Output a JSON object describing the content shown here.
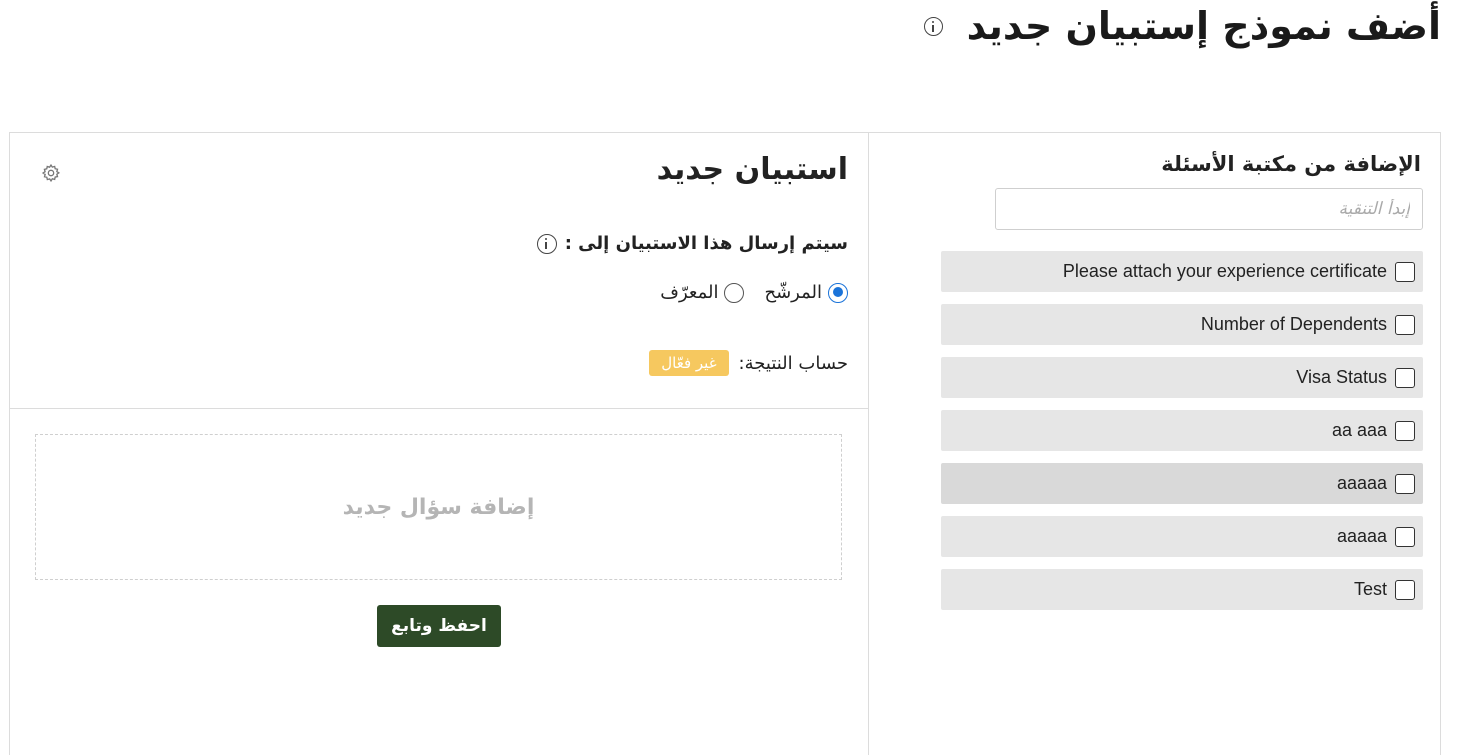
{
  "page": {
    "title": "أضف نموذج إستبيان جديد"
  },
  "library": {
    "title": "الإضافة من مكتبة الأسئلة",
    "search_placeholder": "إبدأ التنقية",
    "items": [
      {
        "label": "Please attach your experience certificate",
        "checked": false
      },
      {
        "label": "Number of Dependents",
        "checked": false
      },
      {
        "label": "Visa Status",
        "checked": false
      },
      {
        "label": "aa aaa",
        "checked": false
      },
      {
        "label": "aaaaa",
        "checked": false
      },
      {
        "label": "aaaaa",
        "checked": false
      },
      {
        "label": "Test",
        "checked": false
      }
    ]
  },
  "survey": {
    "title": "استبيان جديد",
    "send_to_label": "سيتم إرسال هذا الاستبيان إلى :",
    "recipients": [
      {
        "label": "المرشّح",
        "selected": true
      },
      {
        "label": "المعرّف",
        "selected": false
      }
    ],
    "score_label": "حساب النتيجة:",
    "score_status": "غير فعّال",
    "add_question": "إضافة سؤال جديد",
    "save_button": "احفظ وتابع"
  },
  "colors": {
    "primary_button": "#2d4a27",
    "badge": "#f6c85f",
    "radio_accent": "#1a73d9",
    "list_item_bg": "#e6e6e6"
  }
}
